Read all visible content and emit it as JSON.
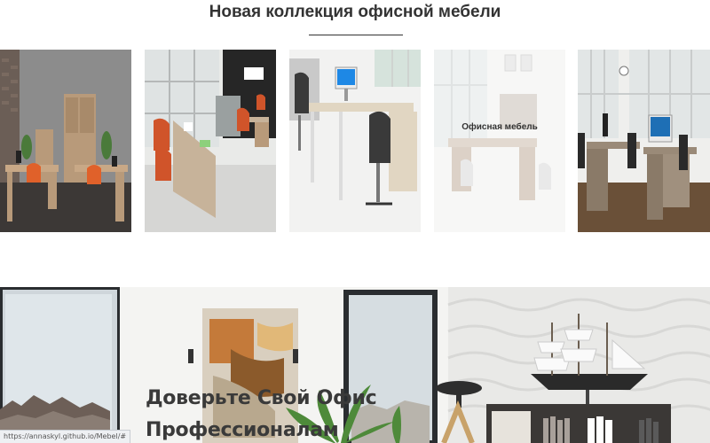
{
  "section": {
    "title": "Новая коллекция офисной мебели"
  },
  "gallery": {
    "items": [
      {
        "caption": "",
        "icon": "office-desks-image"
      },
      {
        "caption": "",
        "icon": "office-room-image"
      },
      {
        "caption": "",
        "icon": "single-workstation-image"
      },
      {
        "caption": "Офисная мебель",
        "icon": "office-furniture-image"
      },
      {
        "caption": "",
        "icon": "office-interior-image"
      }
    ]
  },
  "hero": {
    "heading_line1": "Доверьте Свой Офис",
    "heading_line2": "Профессионалам"
  },
  "status_bar": {
    "url": "https://annaskyl.github.io/Mebel/#"
  },
  "colors": {
    "title": "#333333",
    "wood": "#b89a7a",
    "chair_orange": "#e0612a",
    "floor_dark": "#5b4a3a"
  }
}
